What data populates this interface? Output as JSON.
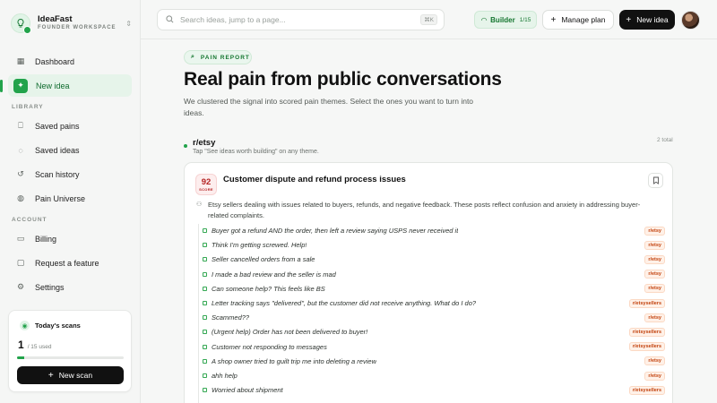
{
  "brand": {
    "name": "IdeaFast",
    "subtitle": "FOUNDER WORKSPACE"
  },
  "sidebar": {
    "nav": [
      {
        "label": "Dashboard",
        "icon": "grid-icon"
      },
      {
        "label": "New idea",
        "icon": "sparkle-icon",
        "active": true
      }
    ],
    "library_heading": "LIBRARY",
    "library": [
      {
        "label": "Saved pains",
        "icon": "bookmark-icon"
      },
      {
        "label": "Saved ideas",
        "icon": "lightbulb-icon"
      },
      {
        "label": "Scan history",
        "icon": "history-icon"
      },
      {
        "label": "Pain Universe",
        "icon": "globe-icon"
      }
    ],
    "account_heading": "ACCOUNT",
    "account": [
      {
        "label": "Billing",
        "icon": "card-icon"
      },
      {
        "label": "Request a feature",
        "icon": "message-icon"
      },
      {
        "label": "Settings",
        "icon": "gear-icon"
      }
    ],
    "scans": {
      "title": "Today's scans",
      "used": "1",
      "limit_text": "/ 15 used",
      "progress_fraction": 0.0667,
      "button": "New scan"
    }
  },
  "topbar": {
    "search_placeholder": "Search ideas, jump to a page...",
    "search_shortcut": "⌘K",
    "builder_label": "Builder",
    "builder_count": "1/15",
    "manage_plan": "Manage plan",
    "new_idea": "New idea"
  },
  "main": {
    "pill": "PAIN REPORT",
    "title": "Real pain from public conversations",
    "description": "We clustered the signal into scored pain themes. Select the ones you want to turn into ideas.",
    "group": {
      "name": "r/etsy",
      "hint": "Tap \"See ideas worth building\" on any theme.",
      "total": "2 total"
    },
    "theme": {
      "score": "92",
      "score_label": "SCORE",
      "title": "Customer dispute and refund process issues",
      "summary": "Etsy sellers dealing with issues related to buyers, refunds, and negative feedback. These posts reflect confusion and anxiety in addressing buyer-related complaints.",
      "posts": [
        {
          "text": "Buyer got a refund AND the order, then left a review saying USPS never received it",
          "tag": "r/etsy"
        },
        {
          "text": "Think I'm getting screwed. Help!",
          "tag": "r/etsy"
        },
        {
          "text": "Seller cancelled orders from a sale",
          "tag": "r/etsy"
        },
        {
          "text": "I made a bad review and the seller is mad",
          "tag": "r/etsy"
        },
        {
          "text": "Can someone help? This feels like BS",
          "tag": "r/etsy"
        },
        {
          "text": "Letter tracking says \"delivered\", but the customer did not receive anything. What do I do?",
          "tag": "r/etsysellers"
        },
        {
          "text": "Scammed??",
          "tag": "r/etsy"
        },
        {
          "text": "(Urgent help) Order has not been delivered to buyer!",
          "tag": "r/etsysellers"
        },
        {
          "text": "Customer not responding to messages",
          "tag": "r/etsysellers"
        },
        {
          "text": "A shop owner tried to guilt trip me into deleting a review",
          "tag": "r/etsy"
        },
        {
          "text": "ahh help",
          "tag": "r/etsy"
        },
        {
          "text": "Worried about shipment",
          "tag": "r/etsysellers"
        }
      ]
    }
  }
}
